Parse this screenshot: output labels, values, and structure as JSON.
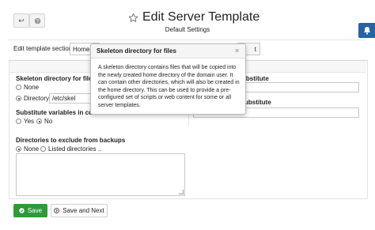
{
  "header": {
    "title": "Edit Server Template",
    "subtitle": "Default Settings",
    "back_icon": "back-arrow-icon",
    "help_icon": "help-icon",
    "star_icon": "star-outline-icon",
    "notify_icon": "bell-icon",
    "notify_color": "#2563a6"
  },
  "section": {
    "label": "Edit template section:",
    "selected": "Home d",
    "right_button_fragment": "t"
  },
  "skeleton": {
    "label": "Skeleton directory for files",
    "options": [
      "None",
      "Directory"
    ],
    "selected_index": 1,
    "value": "/etc/skel"
  },
  "substitute": {
    "label": "Substitute variables in conte",
    "options": [
      "Yes",
      "No"
    ],
    "selected_index": 1
  },
  "right_col": {
    "label1": "ubstitute",
    "label2": "ubstitute"
  },
  "exclude": {
    "label": "Directories to exclude from backups",
    "options": [
      "None",
      "Listed directories .."
    ],
    "selected_index": 0
  },
  "buttons": {
    "save": "Save",
    "save_next": "Save and Next",
    "save_color": "#2f9a39"
  },
  "tooltip": {
    "title": "Skeleton directory for files",
    "close": "×",
    "body": "A skeleton directory contains files that will be copied into the newly created home directory of the domain user. It can contain other directories, which will also be created in the home directory. This can be used to provide a pre-configured set of scripts or web content for some or all server templates."
  }
}
